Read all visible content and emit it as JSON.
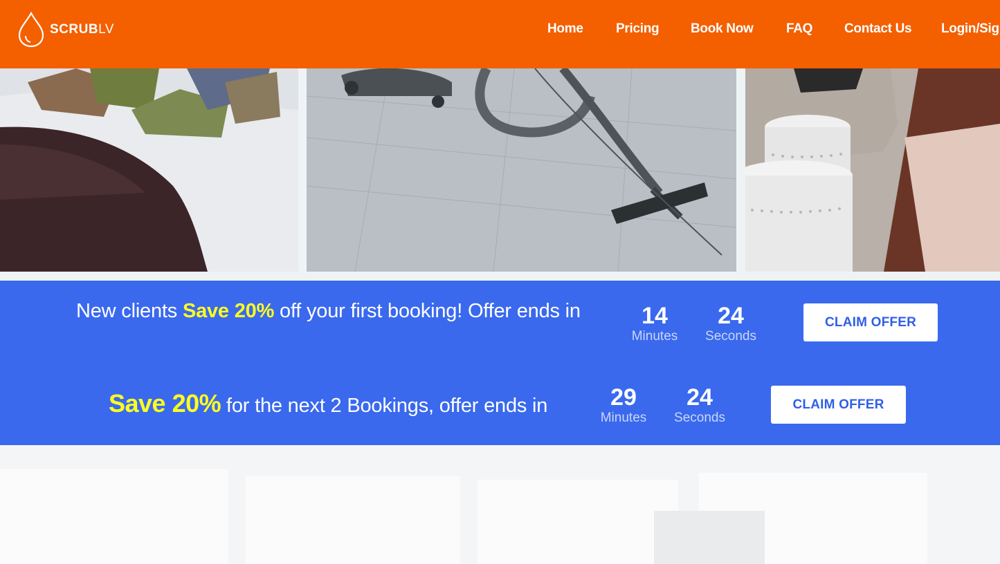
{
  "brand": {
    "name_bold": "SCRUB",
    "name_light": "LV",
    "primary_color": "#f45f00",
    "accent_color": "#3a69ee",
    "highlight_color": "#ffff1f"
  },
  "nav": {
    "items": [
      {
        "label": "Home"
      },
      {
        "label": "Pricing"
      },
      {
        "label": "Book Now"
      },
      {
        "label": "FAQ"
      },
      {
        "label": "Contact Us"
      },
      {
        "label": "Login/Sign"
      }
    ]
  },
  "offers": [
    {
      "text_before": "New clients ",
      "highlight": "Save 20%",
      "text_after": " off your first booking! Offer ends in",
      "minutes_value": "14",
      "minutes_label": "Minutes",
      "seconds_value": "24",
      "seconds_label": "Seconds",
      "button_label": "CLAIM OFFER"
    },
    {
      "text_before": "",
      "highlight": "Save 20%",
      "text_after": " for the next 2 Bookings, offer ends in",
      "minutes_value": "29",
      "minutes_label": "Minutes",
      "seconds_value": "24",
      "seconds_label": "Seconds",
      "button_label": "CLAIM OFFER"
    }
  ]
}
